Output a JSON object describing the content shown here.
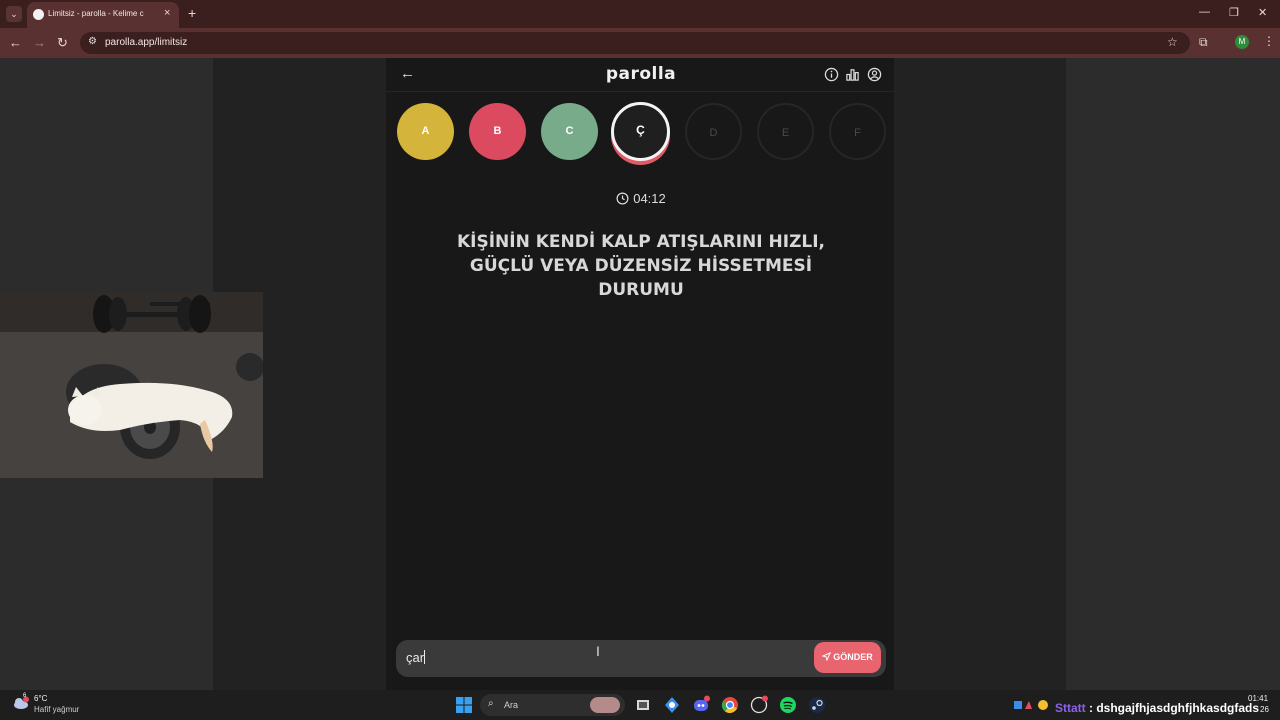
{
  "browser": {
    "tab_title": "Limitsiz - parolla - Kelime c",
    "url": "parolla.app/limitsiz",
    "profile_initial": "M"
  },
  "app": {
    "logo": "parolla",
    "letters": [
      {
        "label": "A",
        "state": "correct",
        "color": "#d4b43a"
      },
      {
        "label": "B",
        "state": "wrong",
        "color": "#dc4a5f"
      },
      {
        "label": "C",
        "state": "correct",
        "color": "#77ab8a"
      },
      {
        "label": "Ç",
        "state": "active"
      },
      {
        "label": "D",
        "state": "pending"
      },
      {
        "label": "E",
        "state": "pending"
      },
      {
        "label": "F",
        "state": "pending"
      }
    ],
    "timer": "04:12",
    "question": "KİŞİNİN KENDİ KALP ATIŞLARINI HIZLI, GÜÇLÜ VEYA DÜZENSİZ HİSSETMESİ DURUMU",
    "answer_value": "çar",
    "send_label": "GÖNDER"
  },
  "taskbar": {
    "weather_temp": "6°C",
    "weather_desc": "Hafif yağmur",
    "weather_badge": "6",
    "search_label": "Ara",
    "tray_name": "Sttatt",
    "tray_message": " : dshgajfhjasdghfjhkasdgfads",
    "clock_time": "01:41",
    "clock_date": "26"
  }
}
